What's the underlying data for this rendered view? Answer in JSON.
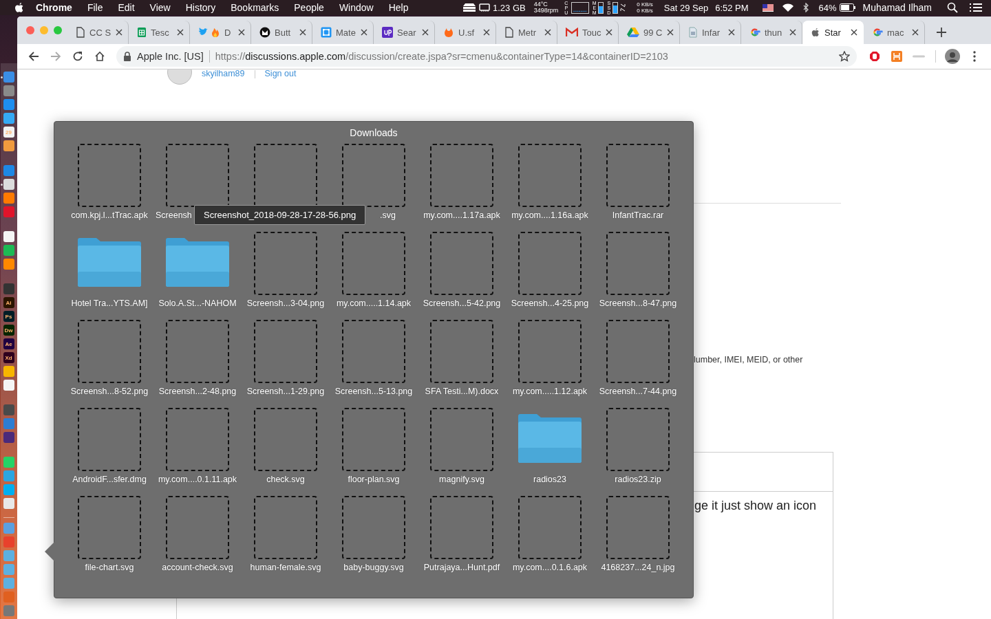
{
  "menubar": {
    "app_name": "Chrome",
    "menus": [
      "File",
      "Edit",
      "View",
      "History",
      "Bookmarks",
      "People",
      "Window",
      "Help"
    ],
    "status": {
      "memory": "1.23 GB",
      "temp": "44°C",
      "fan": "3498rpm",
      "cpu_label": "CPU",
      "mem_label": "MEM",
      "ssd_label": "SSD",
      "net_up": "0 KB/s",
      "net_down": "0 KB/s",
      "date": "Sat 29 Sep",
      "time": "6:52 PM",
      "battery": "64%",
      "user": "Muhamad Ilham"
    }
  },
  "dock": [
    {
      "divider_before": false,
      "apps": [
        {
          "color": "#3a8ee6",
          "running": true
        },
        {
          "color": "#8a8a8a",
          "running": false
        },
        {
          "color": "#1e8ef0",
          "running": false
        },
        {
          "color": "#35aaf5",
          "running": false
        },
        {
          "color": "#f2f2f2",
          "running": false,
          "label": "29"
        },
        {
          "color": "#f09a3e",
          "running": false
        }
      ]
    },
    {
      "divider_before": false,
      "apps": [
        {
          "color": "#1e88e5",
          "running": false
        },
        {
          "color": "#dcdcdc",
          "running": true
        },
        {
          "color": "#ff7a00",
          "running": false
        },
        {
          "color": "#e0142b",
          "running": false
        }
      ]
    },
    {
      "divider_before": false,
      "apps": [
        {
          "color": "#f5f5f5",
          "running": false
        },
        {
          "color": "#1db954",
          "running": false
        },
        {
          "color": "#ff8800",
          "running": false
        }
      ]
    },
    {
      "divider_before": false,
      "apps": [
        {
          "color": "#333333",
          "running": false
        },
        {
          "color": "#2a1500",
          "running": false,
          "label": "Ai"
        },
        {
          "color": "#001d26",
          "running": false,
          "label": "Ps"
        },
        {
          "color": "#072401",
          "running": false,
          "label": "Dw"
        },
        {
          "color": "#1f0040",
          "running": false,
          "label": "Ae"
        },
        {
          "color": "#2e001e",
          "running": false,
          "label": "Xd"
        },
        {
          "color": "#f7b500",
          "running": false
        },
        {
          "color": "#f5f5f5",
          "running": false
        }
      ]
    },
    {
      "divider_before": false,
      "apps": [
        {
          "color": "#4a4a4a",
          "running": false
        },
        {
          "color": "#2d7dd2",
          "running": false
        },
        {
          "color": "#4b2a7a",
          "running": false
        }
      ]
    },
    {
      "divider_before": false,
      "apps": [
        {
          "color": "#25d366",
          "running": false
        },
        {
          "color": "#2ca5e0",
          "running": false
        },
        {
          "color": "#00aff0",
          "running": false
        },
        {
          "color": "#e8e8e8",
          "running": false
        }
      ]
    },
    {
      "divider_before": true,
      "apps": [
        {
          "color": "#5ba0e0",
          "running": false
        },
        {
          "color": "#e8412c",
          "running": false
        },
        {
          "color": "#5db0e0",
          "running": false
        },
        {
          "color": "#5db0e0",
          "running": false
        },
        {
          "color": "#5db0e0",
          "running": false
        },
        {
          "color": "#e06020",
          "running": false
        },
        {
          "color": "#777777",
          "running": false
        }
      ]
    }
  ],
  "tabs": [
    {
      "kind": "doc",
      "title": "CC S",
      "selected": false
    },
    {
      "kind": "sheets",
      "title": "Tesc",
      "selected": false
    },
    {
      "kind": "twitter-fire",
      "title": "D",
      "selected": false
    },
    {
      "kind": "github",
      "title": "Butt",
      "selected": false
    },
    {
      "kind": "frame",
      "title": "Mate",
      "selected": false
    },
    {
      "kind": "up",
      "title": "Sear",
      "selected": false
    },
    {
      "kind": "orange",
      "title": "U.sf",
      "selected": false
    },
    {
      "kind": "doc",
      "title": "Metr",
      "selected": false
    },
    {
      "kind": "gmail",
      "title": "Touc",
      "selected": false
    },
    {
      "kind": "drive",
      "title": "99 C",
      "selected": false
    },
    {
      "kind": "docs",
      "title": "Infar",
      "selected": false
    },
    {
      "kind": "google",
      "title": "thun",
      "selected": false
    },
    {
      "kind": "apple",
      "title": "Star",
      "selected": true
    },
    {
      "kind": "google",
      "title": "mac",
      "selected": false
    }
  ],
  "omnibox": {
    "site": "Apple Inc. [US]",
    "url_scheme": "https://",
    "url_host": "discussions.apple.com",
    "url_path": "/discussion/create.jspa?sr=cmenu&containerType=14&containerID=2103"
  },
  "page": {
    "username": "skyilham89",
    "sign_out": "Sign out",
    "hint": "lumber, IMEI, MEID, or other",
    "body_text": "ge it just show an icon"
  },
  "downloads": {
    "title": "Downloads",
    "tooltip": "Screenshot_2018-09-28-17-28-56.png",
    "items": [
      {
        "kind": "file",
        "label": "com.kpj.l...tTrac.apk"
      },
      {
        "kind": "file",
        "label": "Screensh"
      },
      {
        "kind": "file"
      },
      {
        "kind": "file",
        "label": ".svg"
      },
      {
        "kind": "file",
        "label": "my.com....1.17a.apk"
      },
      {
        "kind": "file",
        "label": "my.com....1.16a.apk"
      },
      {
        "kind": "file",
        "label": "InfantTrac.rar"
      },
      {
        "kind": "folder",
        "label": "Hotel Tra...YTS.AM]"
      },
      {
        "kind": "folder",
        "label": "Solo.A.St...-NAHOM"
      },
      {
        "kind": "file",
        "label": "Screensh...3-04.png"
      },
      {
        "kind": "file",
        "label": "my.com.....1.14.apk"
      },
      {
        "kind": "file",
        "label": "Screensh...5-42.png"
      },
      {
        "kind": "file",
        "label": "Screensh...4-25.png"
      },
      {
        "kind": "file",
        "label": "Screensh...8-47.png"
      },
      {
        "kind": "file",
        "label": "Screensh...8-52.png"
      },
      {
        "kind": "file",
        "label": "Screensh...2-48.png"
      },
      {
        "kind": "file",
        "label": "Screensh...1-29.png"
      },
      {
        "kind": "file",
        "label": "Screensh...5-13.png"
      },
      {
        "kind": "file",
        "label": "SFA Testi...M).docx"
      },
      {
        "kind": "file",
        "label": "my.com.....1.12.apk"
      },
      {
        "kind": "file",
        "label": "Screensh...7-44.png"
      },
      {
        "kind": "file",
        "label": "AndroidF...sfer.dmg"
      },
      {
        "kind": "file",
        "label": "my.com....0.1.11.apk"
      },
      {
        "kind": "file",
        "label": "check.svg"
      },
      {
        "kind": "file",
        "label": "floor-plan.svg"
      },
      {
        "kind": "file",
        "label": "magnify.svg"
      },
      {
        "kind": "folder",
        "label": "radios23"
      },
      {
        "kind": "file",
        "label": "radios23.zip"
      },
      {
        "kind": "file",
        "label": "file-chart.svg"
      },
      {
        "kind": "file",
        "label": "account-check.svg"
      },
      {
        "kind": "file",
        "label": "human-female.svg"
      },
      {
        "kind": "file",
        "label": "baby-buggy.svg"
      },
      {
        "kind": "file",
        "label": "Putrajaya...Hunt.pdf"
      },
      {
        "kind": "file",
        "label": "my.com....0.1.6.apk"
      },
      {
        "kind": "file",
        "label": "4168237...24_n.jpg"
      }
    ]
  }
}
